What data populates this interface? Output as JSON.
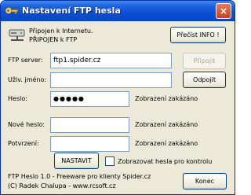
{
  "window": {
    "title": "Nastavení FTP hesla",
    "close_glyph": "×"
  },
  "status": {
    "line1": "Připojen k Internetu.",
    "line2": "PŘIPOJEN k FTP"
  },
  "buttons": {
    "read_info": "Přečíst INFO !",
    "connect": "Připojit",
    "disconnect": "Odpojit",
    "set": "NASTAVIT",
    "close": "Konec"
  },
  "form": {
    "ftp_server_label": "FTP server:",
    "ftp_server_value": "ftp1.spider.cz",
    "username_label": "Uživ. jméno:",
    "username_value": "",
    "password_label": "Heslo:",
    "password_value": "●●●●●",
    "password_note": "Zobrazení zakázáno",
    "new_password_label": "Nové heslo:",
    "new_password_value": "",
    "new_password_note": "Zobrazení zakázáno",
    "confirm_label": "Potvrzení:",
    "confirm_value": "",
    "confirm_note": "Zobrazení zakázáno",
    "show_passwords_label": "Zobrazovat hesla pro kontrolu",
    "show_passwords_checked": false
  },
  "footer": {
    "line1": "FTP Heslo 1.0 - Freeware pro klienty Spider.cz",
    "line2": "(C) Radek Chalupa - www.rcsoft.cz"
  },
  "icons": {
    "app": "key-icon",
    "connection": "network-drive-icon",
    "close": "close-icon"
  },
  "colors": {
    "titlebar": "#0a4fd3",
    "window_bg": "#ece9d8",
    "close_button": "#c6411f"
  }
}
